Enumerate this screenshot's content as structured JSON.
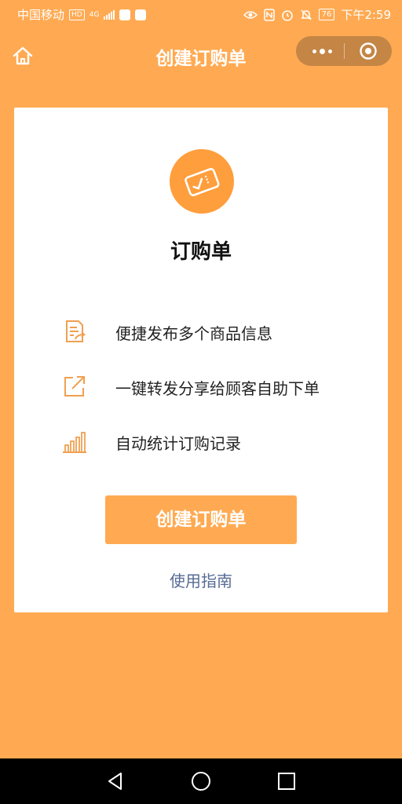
{
  "status_bar": {
    "carrier": "中国移动",
    "hd_badge": "HD",
    "network": "4G",
    "battery": "76",
    "time": "下午2:59",
    "icons": [
      "signal-icon",
      "video-app-icon",
      "browser-app-icon",
      "eye-icon",
      "nfc-icon",
      "alarm-icon",
      "mute-icon",
      "battery-icon"
    ]
  },
  "nav": {
    "title": "创建订购单",
    "icons": [
      "home-icon",
      "more-icon",
      "close-target-icon"
    ]
  },
  "card": {
    "title": "订购单",
    "hero_icon": "ticket-icon",
    "features": [
      {
        "icon": "edit-document-icon",
        "text": "便捷发布多个商品信息"
      },
      {
        "icon": "share-icon",
        "text": "一键转发分享给顾客自助下单"
      },
      {
        "icon": "bar-chart-icon",
        "text": "自动统计订购记录"
      }
    ],
    "primary_button": "创建订购单",
    "guide_link": "使用指南"
  },
  "system_nav": {
    "icons": [
      "back-icon",
      "home-circle-icon",
      "recents-icon"
    ]
  },
  "colors": {
    "background": "#FFAA52",
    "accent": "#FF9E3C",
    "capsule": "#C48545",
    "link": "#576B95"
  }
}
